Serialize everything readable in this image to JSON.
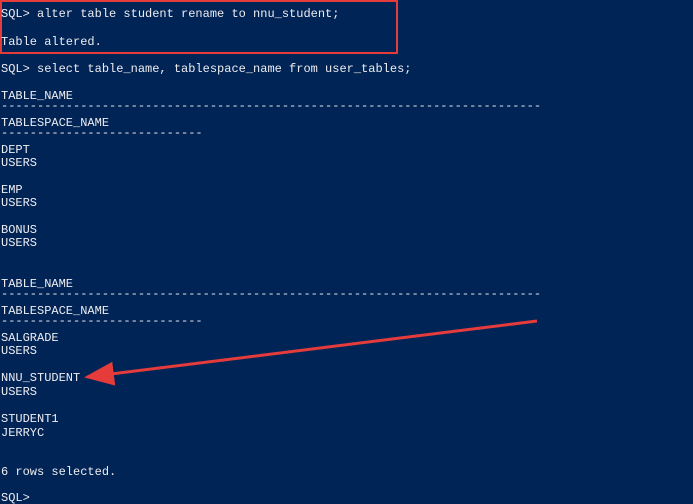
{
  "terminal": {
    "prompt": "SQL>",
    "commands": {
      "rename": "SQL> alter table student rename to nnu_student;",
      "rename_result": "Table altered.",
      "select": "SQL> select table_name, tablespace_name from user_tables;"
    },
    "headers": {
      "table_name": "TABLE_NAME",
      "tablespace_name": "TABLESPACE_NAME",
      "long_dashes": "--------------------------------------------------------------------------------",
      "short_dashes": "------------------------------"
    },
    "rows": [
      {
        "table_name": "DEPT",
        "tablespace_name": "USERS"
      },
      {
        "table_name": "EMP",
        "tablespace_name": "USERS"
      },
      {
        "table_name": "BONUS",
        "tablespace_name": "USERS"
      },
      {
        "table_name": "SALGRADE",
        "tablespace_name": "USERS"
      },
      {
        "table_name": "NNU_STUDENT",
        "tablespace_name": "USERS"
      },
      {
        "table_name": "STUDENT1",
        "tablespace_name": "JERRYC"
      }
    ],
    "footer": "6 rows selected.",
    "final_prompt": "SQL>"
  },
  "annotation": {
    "highlight_color": "#e53b3b",
    "arrow_color": "#e53b3b"
  }
}
